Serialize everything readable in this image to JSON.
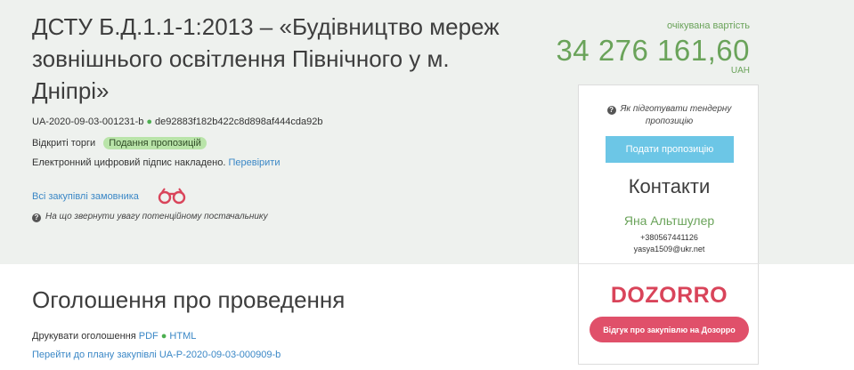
{
  "tender": {
    "title": "ДСТУ Б.Д.1.1-1:2013 – «Будівництво мереж зовнішнього освітлення Північного у м. Дніпрі»",
    "id": "UA-2020-09-03-001231-b",
    "hash": "de92883f182b422c8d898af444cda92b",
    "procedure_type": "Відкриті торги",
    "status": "Подання пропозицій",
    "signature_text": "Електронний цифровий підпис накладено.",
    "signature_link": "Перевірити",
    "all_purchases_link": "Всі закупівлі замовника",
    "hint_text": "На що звернути увагу потенційному постачальнику"
  },
  "price": {
    "label": "очікувана вартість",
    "value": "34 276 161,60",
    "currency": "UAH"
  },
  "panel": {
    "prep_tip": "Як підготувати тендерну пропозицію",
    "submit_label": "Подати пропозицію",
    "contacts_title": "Контакти",
    "contact_name": "Яна Альтшулер",
    "contact_phone": "+380567441126",
    "contact_email": "yasya1509@ukr.net",
    "dozorro_logo": "DOZORRO",
    "dozorro_button": "Відгук про закупівлю на Дозорро"
  },
  "announcement": {
    "title": "Оголошення про проведення",
    "print_label": "Друкувати оголошення",
    "pdf_link": "PDF",
    "html_link": "HTML",
    "plan_link": "Перейти до плану закупівлі UA-P-2020-09-03-000909-b"
  },
  "icons": {
    "hint": "question-icon",
    "binoculars": "binoculars-icon"
  },
  "colors": {
    "accent_green": "#6aa35a",
    "link_blue": "#3a87c6",
    "submit_blue": "#6cc6e6",
    "dozorro_red": "#e0506a",
    "status_badge": "#b9e4a9"
  }
}
